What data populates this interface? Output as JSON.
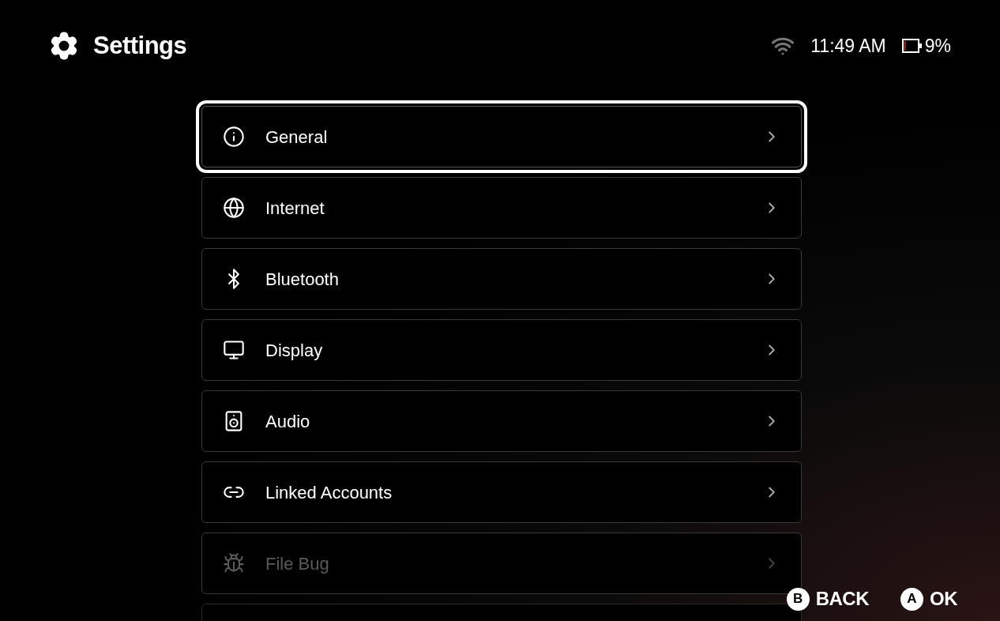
{
  "header": {
    "title": "Settings"
  },
  "status": {
    "time": "11:49 AM",
    "battery": {
      "level": 0.09,
      "reading": "9%"
    }
  },
  "menu": {
    "items": [
      {
        "kind": "info",
        "label": "General",
        "selected": true,
        "disabled": false
      },
      {
        "kind": "globe",
        "label": "Internet",
        "selected": false,
        "disabled": false
      },
      {
        "kind": "bluetooth",
        "label": "Bluetooth",
        "selected": false,
        "disabled": false
      },
      {
        "kind": "display",
        "label": "Display",
        "selected": false,
        "disabled": false
      },
      {
        "kind": "audio",
        "label": "Audio",
        "selected": false,
        "disabled": false
      },
      {
        "kind": "link",
        "label": "Linked Accounts",
        "selected": false,
        "disabled": false
      },
      {
        "kind": "bug",
        "label": "File Bug",
        "selected": false,
        "disabled": true
      }
    ],
    "more_below": true
  },
  "footer": {
    "buttons": [
      {
        "key": "B",
        "label": "BACK"
      },
      {
        "key": "A",
        "label": "OK"
      }
    ]
  }
}
